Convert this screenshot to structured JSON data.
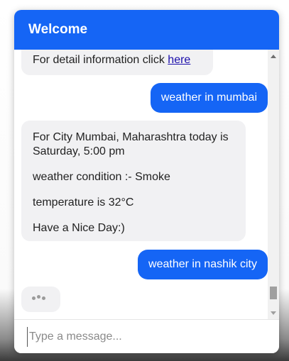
{
  "header": {
    "title": "Welcome"
  },
  "messages": {
    "partial_text": "For detail information click",
    "partial_link": "here",
    "user_1": "weather in mumbai",
    "bot_lines": [
      "For City Mumbai, Maharashtra today is Saturday, 5:00 pm",
      "weather condition :- Smoke",
      "temperature is 32°C",
      "Have a Nice Day:)"
    ],
    "user_2": "weather in nashik city"
  },
  "composer": {
    "placeholder": "Type a message..."
  },
  "colors": {
    "accent": "#1565f5",
    "bot_bubble": "#f1f1f3"
  }
}
